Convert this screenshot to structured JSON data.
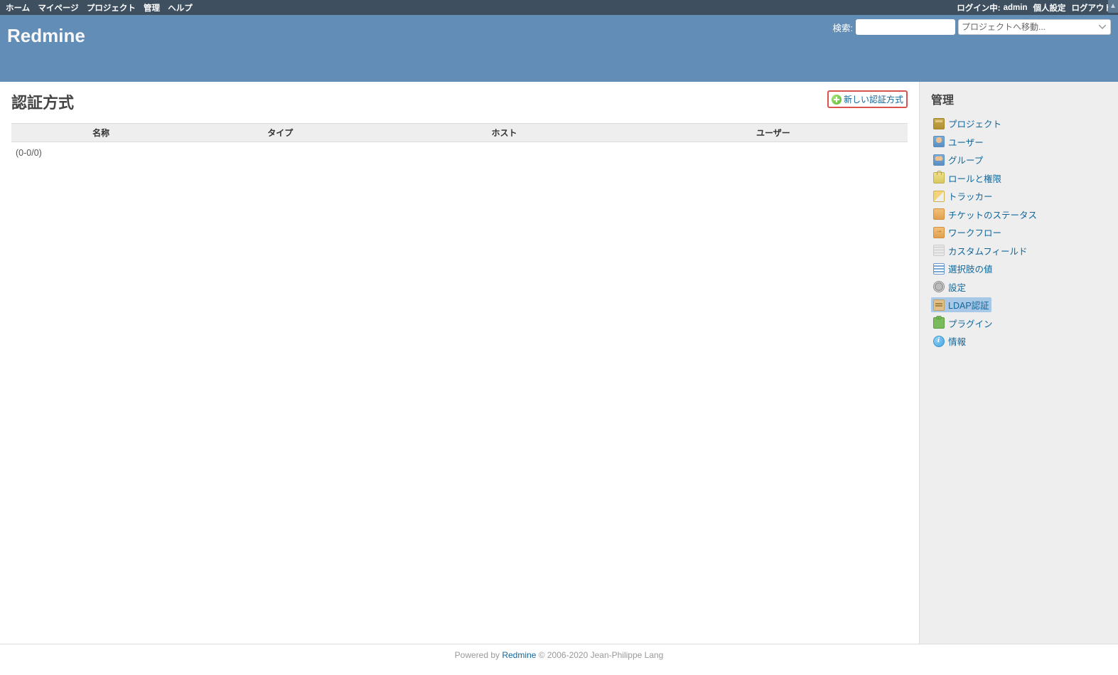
{
  "top_menu": {
    "left": [
      {
        "label": "ホーム"
      },
      {
        "label": "マイページ"
      },
      {
        "label": "プロジェクト"
      },
      {
        "label": "管理"
      },
      {
        "label": "ヘルプ"
      }
    ],
    "logged_in_as_label": "ログイン中:",
    "user": "admin",
    "right": [
      {
        "label": "個人設定"
      },
      {
        "label": "ログアウト"
      }
    ]
  },
  "header": {
    "app_title": "Redmine",
    "search_label": "検索:",
    "project_jump_placeholder": "プロジェクトへ移動..."
  },
  "content": {
    "page_title": "認証方式",
    "new_auth_label": "新しい認証方式",
    "table": {
      "headers": [
        "名称",
        "タイプ",
        "ホスト",
        "ユーザー"
      ]
    },
    "pagination": "(0-0/0)"
  },
  "sidebar": {
    "title": "管理",
    "items": [
      {
        "label": "プロジェクト",
        "icon": "i-box"
      },
      {
        "label": "ユーザー",
        "icon": "i-user"
      },
      {
        "label": "グループ",
        "icon": "i-users"
      },
      {
        "label": "ロールと権限",
        "icon": "i-lock"
      },
      {
        "label": "トラッカー",
        "icon": "i-tag"
      },
      {
        "label": "チケットのステータス",
        "icon": "i-status"
      },
      {
        "label": "ワークフロー",
        "icon": "i-flow"
      },
      {
        "label": "カスタムフィールド",
        "icon": "i-field"
      },
      {
        "label": "選択肢の値",
        "icon": "i-list"
      },
      {
        "label": "設定",
        "icon": "i-gear"
      },
      {
        "label": "LDAP認証",
        "icon": "i-server",
        "selected": true
      },
      {
        "label": "プラグイン",
        "icon": "i-plugin"
      },
      {
        "label": "情報",
        "icon": "i-info"
      }
    ]
  },
  "footer": {
    "powered_by": "Powered by ",
    "app": "Redmine",
    "copyright": " © 2006-2020 Jean-Philippe Lang"
  }
}
